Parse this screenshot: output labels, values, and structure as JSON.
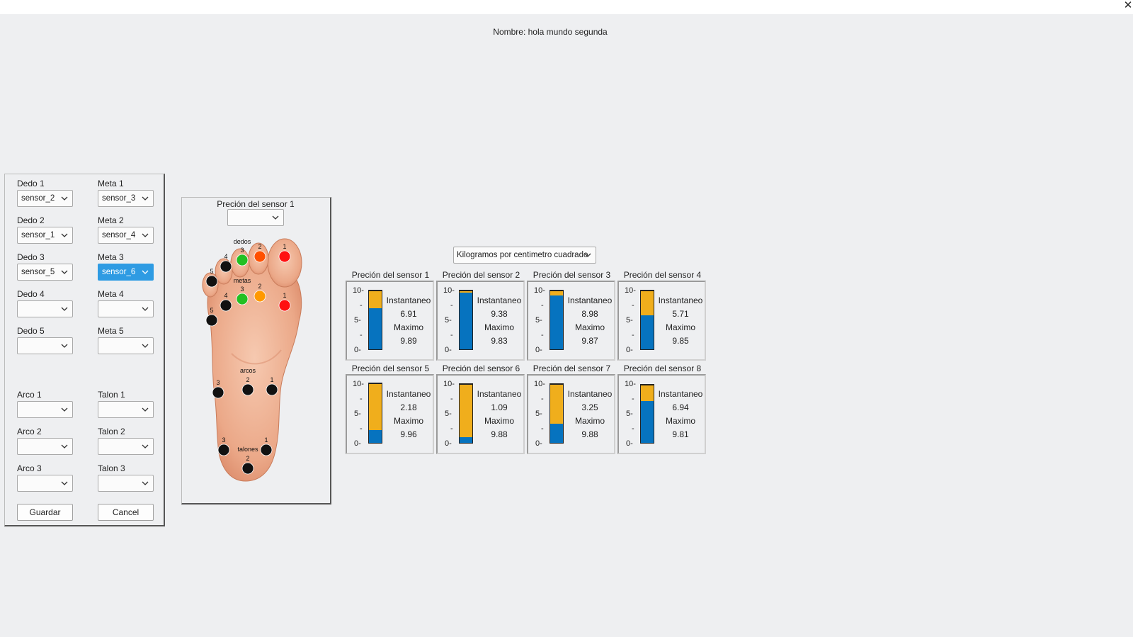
{
  "window": {
    "close_label": "✕"
  },
  "header": {
    "name_label": "Nombre: hola mundo segunda"
  },
  "config": {
    "fields": [
      {
        "label": "Dedo 1",
        "value": "sensor_2",
        "selected": false
      },
      {
        "label": "Meta 1",
        "value": "sensor_3",
        "selected": false
      },
      {
        "label": "Dedo 2",
        "value": "sensor_1",
        "selected": false
      },
      {
        "label": "Meta 2",
        "value": "sensor_4",
        "selected": false
      },
      {
        "label": "Dedo 3",
        "value": "sensor_5",
        "selected": false
      },
      {
        "label": "Meta 3",
        "value": "sensor_6",
        "selected": true
      },
      {
        "label": "Dedo 4",
        "value": "",
        "selected": false
      },
      {
        "label": "Meta 4",
        "value": "",
        "selected": false
      },
      {
        "label": "Dedo 5",
        "value": "",
        "selected": false
      },
      {
        "label": "Meta 5",
        "value": "",
        "selected": false
      },
      {
        "label": "Arco 1",
        "value": "",
        "selected": false
      },
      {
        "label": "Talon 1",
        "value": "",
        "selected": false
      },
      {
        "label": "Arco 2",
        "value": "",
        "selected": false
      },
      {
        "label": "Talon 2",
        "value": "",
        "selected": false
      },
      {
        "label": "Arco 3",
        "value": "",
        "selected": false
      },
      {
        "label": "Talon 3",
        "value": "",
        "selected": false
      }
    ],
    "save_label": "Guardar",
    "cancel_label": "Cancel"
  },
  "foot": {
    "title": "Preción del sensor 1",
    "sensor_select_value": "",
    "groups": {
      "dedos": "dedos",
      "metas": "metas",
      "arcos": "arcos",
      "talones": "talones"
    },
    "point_colors": {
      "dedos": [
        "#ff1111",
        "#ff5000",
        "#22c022",
        "#111111",
        "#111111"
      ],
      "metas": [
        "#ff1111",
        "#ff9900",
        "#22c022",
        "#111111",
        "#111111"
      ],
      "arcos": [
        "#111111",
        "#111111",
        "#111111"
      ],
      "talones": [
        "#111111",
        "#111111",
        "#111111"
      ]
    },
    "labels": {
      "dedos": [
        "1",
        "2",
        "3",
        "4",
        "5"
      ],
      "metas": [
        "1",
        "2",
        "3",
        "4",
        "5"
      ],
      "arcos": [
        "1",
        "2",
        "3"
      ],
      "talones": [
        "1",
        "2",
        "3"
      ]
    }
  },
  "units": {
    "selected": "Kilogramos por centimetro cuadrado"
  },
  "sensors": {
    "axis": {
      "max": 10,
      "mid": 5,
      "min": 0,
      "tick_top": "10-",
      "tick_mid": "5-",
      "tick_min": "0-",
      "tick_minor": "-"
    },
    "instant_label": "Instantaneo",
    "max_label": "Maximo",
    "colors": {
      "max_bar": "#f0ae1c",
      "instant_bar": "#0673bf"
    },
    "items": [
      {
        "title": "Preción del sensor 1",
        "instant": "6.91",
        "max": "9.89"
      },
      {
        "title": "Preción del sensor 2",
        "instant": "9.38",
        "max": "9.83"
      },
      {
        "title": "Preción del sensor 3",
        "instant": "8.98",
        "max": "9.87"
      },
      {
        "title": "Preción del sensor 4",
        "instant": "5.71",
        "max": "9.85"
      },
      {
        "title": "Preción del sensor 5",
        "instant": "2.18",
        "max": "9.96"
      },
      {
        "title": "Preción del sensor 6",
        "instant": "1.09",
        "max": "9.88"
      },
      {
        "title": "Preción del sensor 7",
        "instant": "3.25",
        "max": "9.88"
      },
      {
        "title": "Preción del sensor 8",
        "instant": "6.94",
        "max": "9.81"
      }
    ]
  }
}
